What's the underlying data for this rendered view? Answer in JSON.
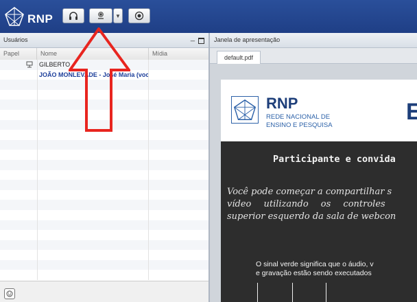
{
  "app": {
    "logo_text": "RNP"
  },
  "toolbar": {
    "buttons": [
      {
        "icon": "headset-icon"
      },
      {
        "icon": "webcam-icon"
      },
      {
        "icon": "chevron-down-icon",
        "label": "▼"
      },
      {
        "icon": "record-icon"
      }
    ]
  },
  "users_panel": {
    "title": "Usuários",
    "columns": {
      "papel": "Papel",
      "nome": "Nome",
      "midia": "Mídia"
    },
    "users": [
      {
        "name": "GILBERTO",
        "role_icon": "presenter-icon",
        "is_me": false
      },
      {
        "name": "JOÃO MONLEVADE - José Maria (você)",
        "is_me": true
      }
    ],
    "footer_icon": "emoji-icon"
  },
  "annotation": {
    "arrow_color": "#e8251f"
  },
  "presentation": {
    "title": "Janela de apresentação",
    "tab": "default.pdf",
    "slide": {
      "logo_text": "RNP",
      "logo_sub_1": "REDE NACIONAL DE",
      "logo_sub_2": "ENSINO E PESQUISA",
      "big_letter": "E",
      "heading": "Participante e convida",
      "body_1": "Você pode começar a compartilhar s",
      "body_2": "vídeo utilizando os controles",
      "body_3": "superior esquerdo da sala de webcon",
      "note_1": "O sinal verde significa que o áudio, v",
      "note_2": "e gravação estão sendo executados"
    }
  },
  "colors": {
    "topbar": "#1f3f86",
    "brand_blue": "#1e3f7a",
    "chalkboard": "#2d2d2d"
  }
}
